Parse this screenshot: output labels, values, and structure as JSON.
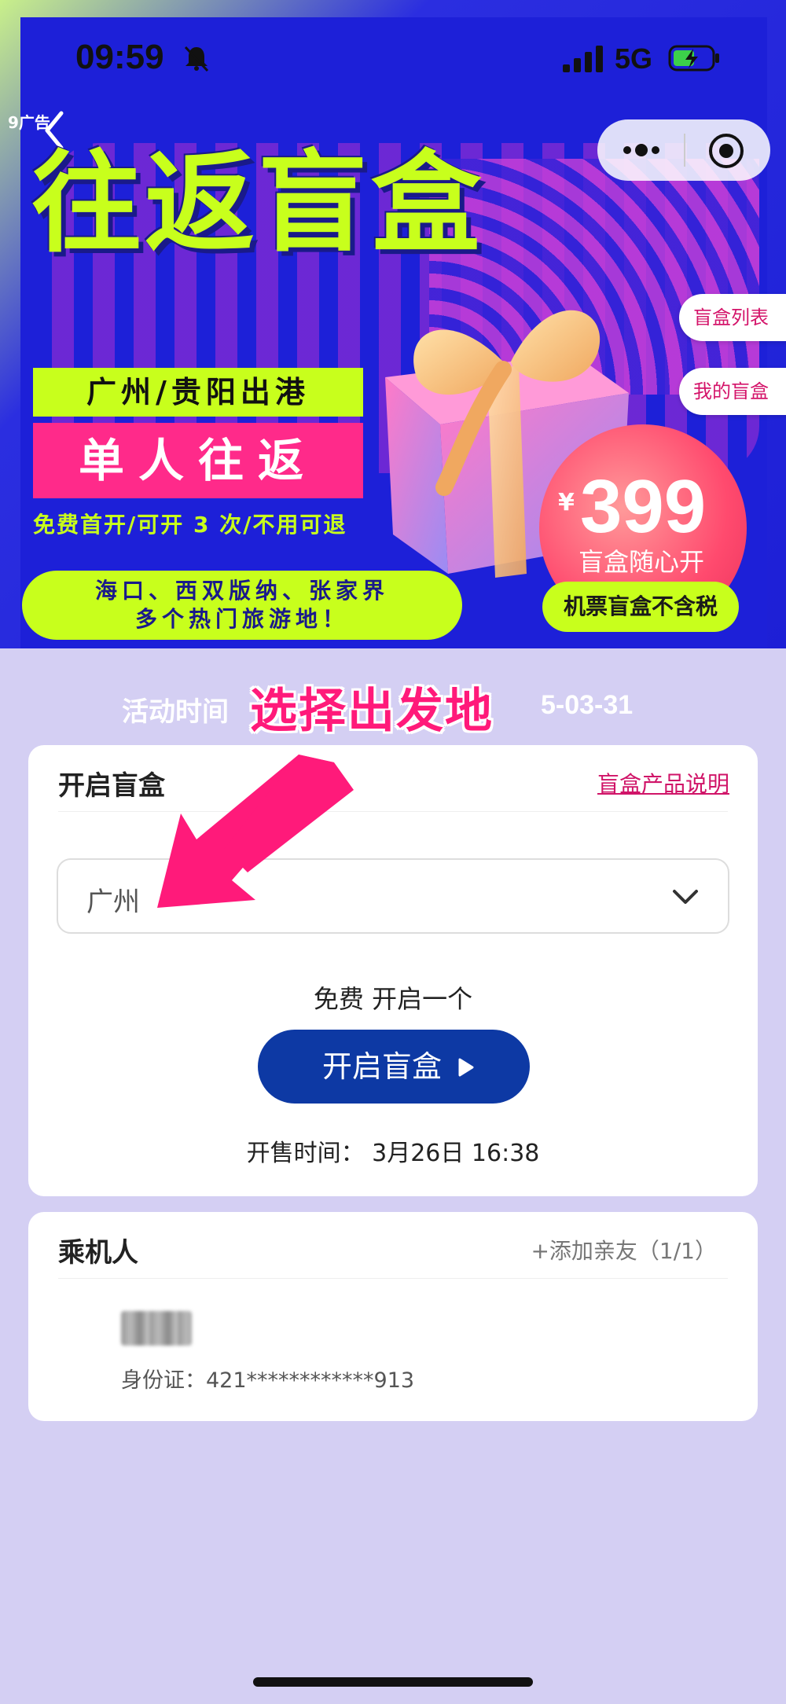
{
  "status_bar": {
    "time": "09:59",
    "network": "5G"
  },
  "banner": {
    "ad_tag": "9广告",
    "headline": "往返盲盒",
    "route": "广州/贵阳出港",
    "trip_type": "单人往返",
    "perks": "免费首开/可开 3 次/不用可退",
    "destinations_line1": "海口、西双版纳、张家界",
    "destinations_line2": "多个热门旅游地！",
    "currency": "¥",
    "price": "399",
    "price_sub": "盲盒随心开",
    "tax_note": "机票盲盒不含税",
    "side_buttons": {
      "list": "盲盒列表",
      "mine": "我的盲盒"
    }
  },
  "activity": {
    "label": "活动时间",
    "end": "5-03-31",
    "hint": "选择出发地"
  },
  "open_card": {
    "title": "开启盲盒",
    "link": "盲盒产品说明",
    "city_value": "广州",
    "free_label": "免费 开启一个",
    "open_button": "开启盲盒",
    "sale_time": "开售时间：  3月26日 16:38"
  },
  "passenger_card": {
    "title": "乘机人",
    "add_friend": "+添加亲友（1/1）",
    "id_number": "身份证：421************913"
  },
  "colors": {
    "accent_pink": "#ff1a7a",
    "button_blue": "#0d39a4",
    "lime": "#c8ff1c",
    "page_bg": "#d4cff3"
  }
}
